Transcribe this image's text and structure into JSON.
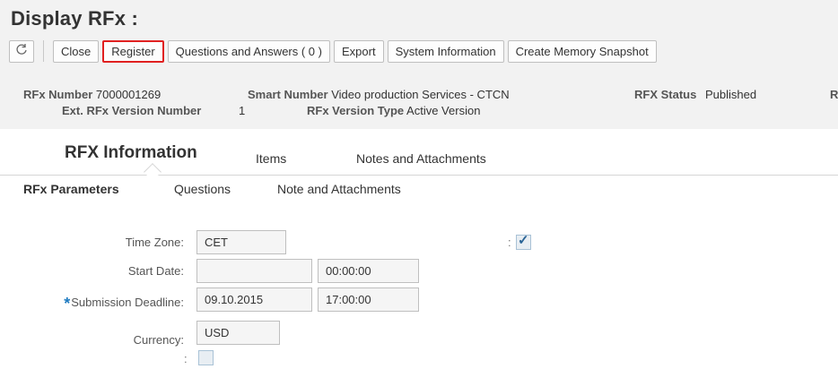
{
  "page": {
    "title": "Display RFx :"
  },
  "toolbar": {
    "refresh_icon": "refresh-icon",
    "buttons": [
      "Close",
      "Register",
      "Questions and Answers ( 0 )",
      "Export",
      "System Information",
      "Create Memory Snapshot"
    ],
    "highlight_color": "#e02020"
  },
  "header": {
    "rfx_number_label": "RFx Number",
    "rfx_number": "7000001269",
    "smart_number_label": "Smart Number",
    "smart_number": "Video production Services - CTCN",
    "rfx_status_label": "RFX Status",
    "rfx_status": "Published",
    "truncated_label": "R",
    "ext_version_label": "Ext. RFx Version Number",
    "ext_version": "1",
    "version_type_label": "RFx Version Type",
    "version_type": "Active Version"
  },
  "tabs": {
    "main": "RFX Information",
    "items": "Items",
    "notes": "Notes and Attachments"
  },
  "subtabs": {
    "params": "RFx Parameters",
    "questions": "Questions",
    "notes": "Note and Attachments"
  },
  "form": {
    "time_zone_label": "Time Zone:",
    "time_zone": "CET",
    "start_date_label": "Start Date:",
    "start_date": "",
    "start_time": "00:00:00",
    "deadline_label": "Submission Deadline:",
    "deadline_date": "09.10.2015",
    "deadline_time": "17:00:00",
    "currency_label": "Currency:",
    "currency": "USD",
    "colon": ":",
    "checkbox1_checked": true,
    "checkbox2_checked": false
  },
  "colors": {
    "accent": "#1f7bc1",
    "header_bg": "#f2f2f2"
  }
}
